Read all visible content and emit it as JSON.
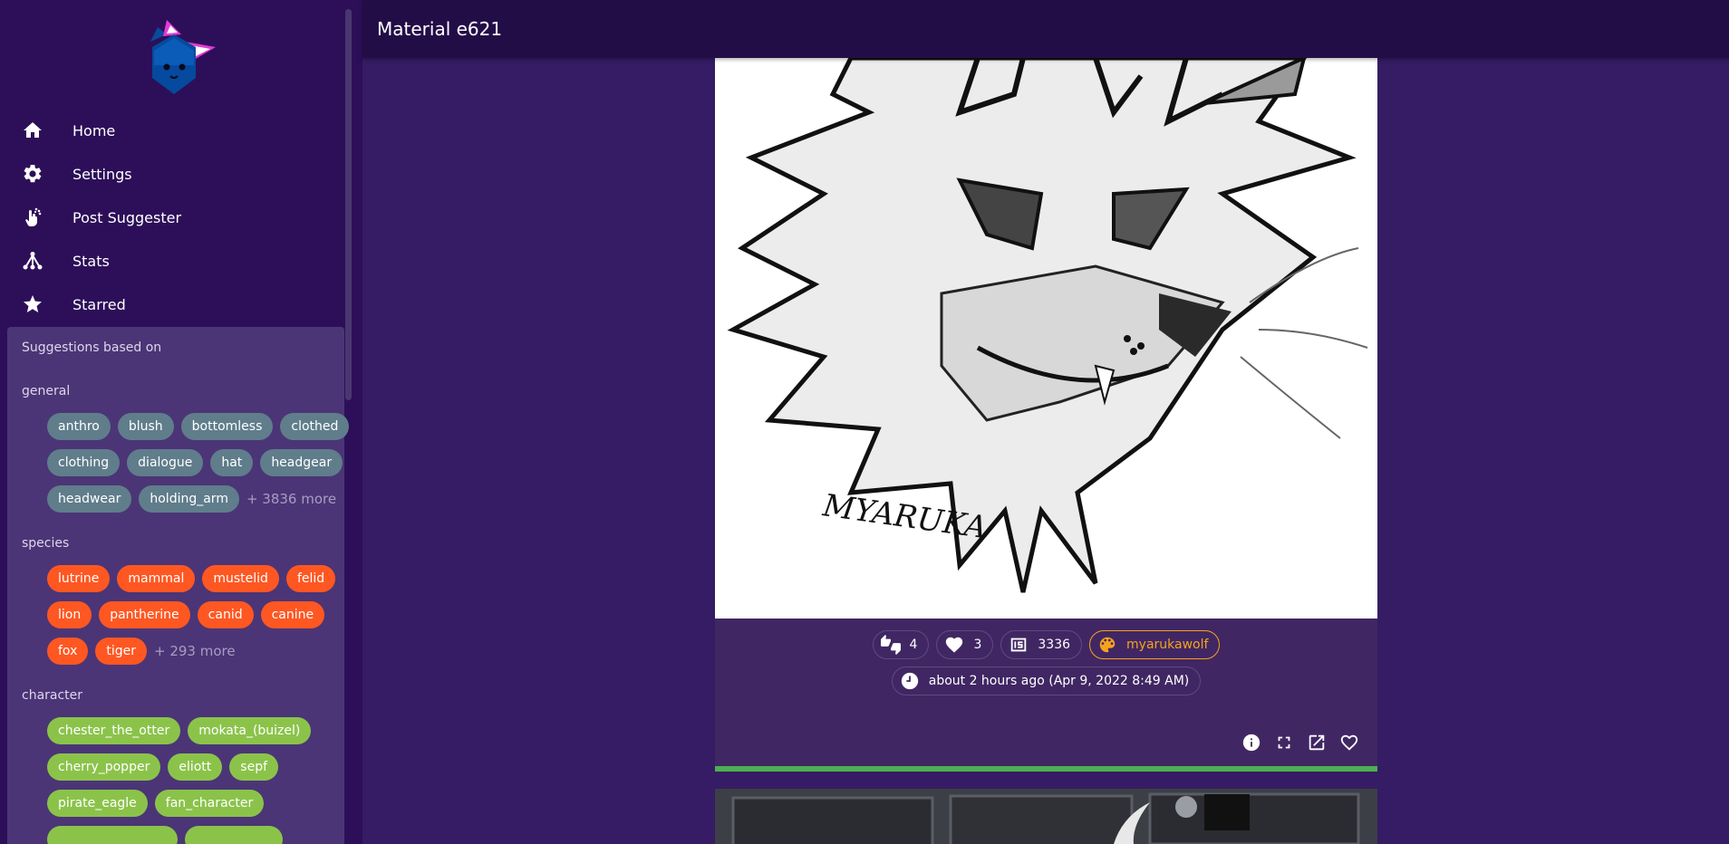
{
  "app": {
    "title": "Material e621"
  },
  "nav": [
    {
      "label": "Home",
      "icon": "home-icon"
    },
    {
      "label": "Settings",
      "icon": "gear-icon"
    },
    {
      "label": "Post Suggester",
      "icon": "touch-app-icon"
    },
    {
      "label": "Stats",
      "icon": "graph-icon"
    },
    {
      "label": "Starred",
      "icon": "star-icon"
    }
  ],
  "suggestions": {
    "title": "Suggestions based on",
    "groups": [
      {
        "label": "general",
        "color": "#607d8b",
        "rows": [
          [
            "anthro",
            "blush",
            "bottomless",
            "clothed"
          ],
          [
            "clothing",
            "dialogue",
            "hat",
            "headgear"
          ],
          [
            "headwear",
            "holding_arm"
          ]
        ],
        "more": "+ 3836 more"
      },
      {
        "label": "species",
        "color": "#ff5722",
        "rows": [
          [
            "lutrine",
            "mammal",
            "mustelid",
            "felid"
          ],
          [
            "lion",
            "pantherine",
            "canid",
            "canine"
          ],
          [
            "fox",
            "tiger"
          ]
        ],
        "more": "+ 293 more"
      },
      {
        "label": "character",
        "color": "#8bc34a",
        "rows": [
          [
            "chester_the_otter",
            "mokata_(buizel)"
          ],
          [
            "cherry_popper",
            "eliott",
            "sepf"
          ],
          [
            "pirate_eagle",
            "fan_character"
          ]
        ],
        "more": ""
      }
    ]
  },
  "post": {
    "score": "4",
    "favorites": "3",
    "id": "3336",
    "artist": "myarukawolf",
    "time": "about 2 hours ago (Apr 9, 2022 8:49 AM)",
    "signature": "MYARUKA",
    "progress": 1.0,
    "actions": [
      "info-icon",
      "fullscreen-icon",
      "open-external-icon",
      "heart-outline-icon"
    ]
  },
  "colors": {
    "sidebar": "#2d0f59",
    "topbar": "#230d47",
    "background": "#351c64",
    "artist": "#f7a21e",
    "progress": "#4caf50"
  }
}
